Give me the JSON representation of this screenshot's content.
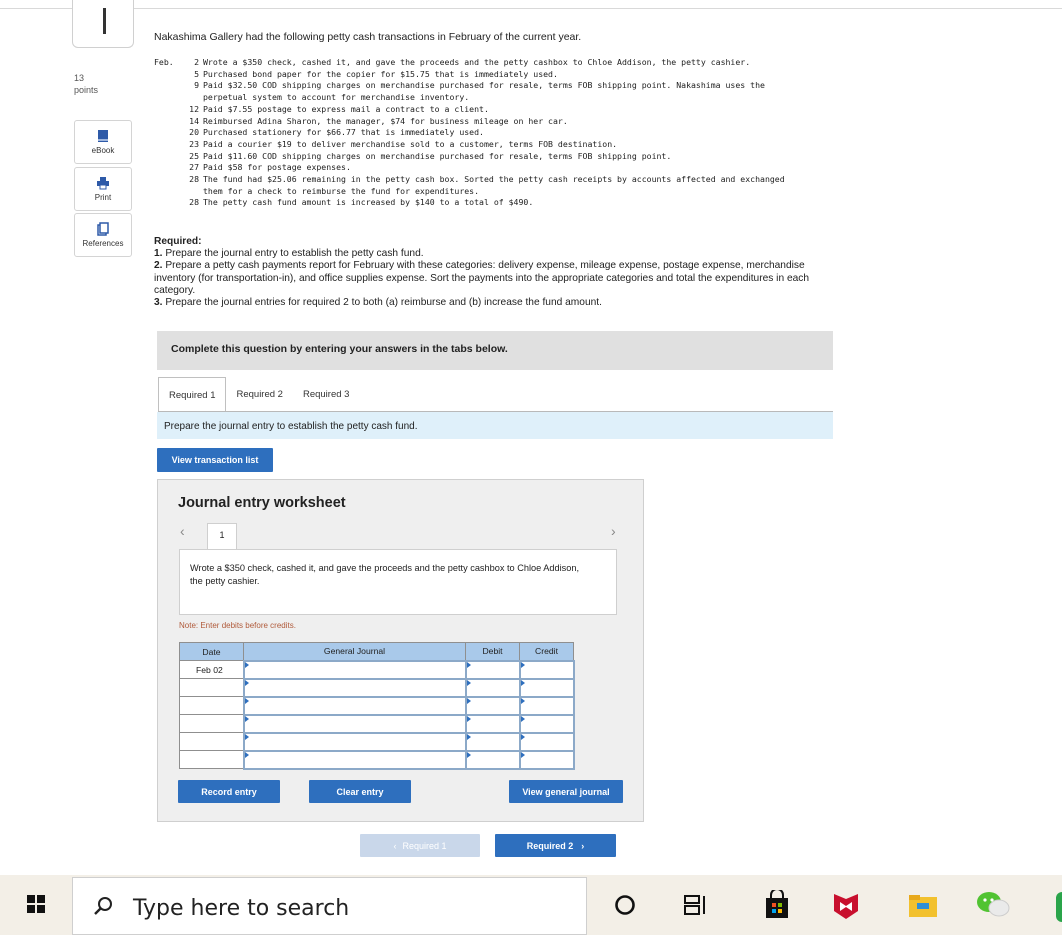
{
  "sidebar": {
    "points_value": "13",
    "points_label": "points",
    "buttons": [
      {
        "label": "eBook",
        "icon": "book-icon"
      },
      {
        "label": "Print",
        "icon": "printer-icon"
      },
      {
        "label": "References",
        "icon": "references-icon"
      }
    ]
  },
  "question": {
    "intro": "Nakashima Gallery had the following petty cash transactions in February of the current year.",
    "month": "Feb.",
    "transactions": [
      {
        "day": "2",
        "text": "Wrote a $350 check, cashed it, and gave the proceeds and the petty cashbox to Chloe Addison, the petty cashier."
      },
      {
        "day": "5",
        "text": "Purchased bond paper for the copier for $15.75 that is immediately used."
      },
      {
        "day": "9",
        "text": "Paid $32.50 COD shipping charges on merchandise purchased for resale, terms FOB shipping point. Nakashima uses the"
      },
      {
        "day": "",
        "text": "perpetual system to account for merchandise inventory."
      },
      {
        "day": "12",
        "text": "Paid $7.55 postage to express mail a contract to a client."
      },
      {
        "day": "14",
        "text": "Reimbursed Adina Sharon, the manager, $74 for business mileage on her car."
      },
      {
        "day": "20",
        "text": "Purchased stationery for $66.77 that is immediately used."
      },
      {
        "day": "23",
        "text": "Paid a courier $19 to deliver merchandise sold to a customer, terms FOB destination."
      },
      {
        "day": "25",
        "text": "Paid $11.60 COD shipping charges on merchandise purchased for resale, terms FOB shipping point."
      },
      {
        "day": "27",
        "text": "Paid $58 for postage expenses."
      },
      {
        "day": "28",
        "text": "The fund had $25.06 remaining in the petty cash box. Sorted the petty cash receipts by accounts affected and exchanged"
      },
      {
        "day": "",
        "text": "them for a check to reimburse the fund for expenditures."
      },
      {
        "day": "28",
        "text": "The petty cash fund amount is increased by $140 to a total of $490."
      }
    ],
    "required_heading": "Required:",
    "required": [
      {
        "num": "1.",
        "text": " Prepare the journal entry to establish the petty cash fund."
      },
      {
        "num": "2.",
        "text": " Prepare a petty cash payments report for February with these categories: delivery expense, mileage expense, postage expense, merchandise inventory (for transportation-in), and office supplies expense. Sort the payments into the appropriate categories and total the expenditures in each category."
      },
      {
        "num": "3.",
        "text": " Prepare the journal entries for required 2 to both (a) reimburse and (b) increase the fund amount."
      }
    ]
  },
  "banner": "Complete this question by entering your answers in the tabs below.",
  "tabs": [
    "Required 1",
    "Required 2",
    "Required 3"
  ],
  "tab_instruction": "Prepare the journal entry to establish the petty cash fund.",
  "view_transaction_button": "View transaction list",
  "worksheet": {
    "title": "Journal entry worksheet",
    "prev_icon": "chevron-left-icon",
    "next_icon": "chevron-right-icon",
    "page": "1",
    "description": "Wrote a $350 check, cashed it, and gave the proceeds and the petty cashbox to Chloe Addison, the petty cashier.",
    "note": "Note: Enter debits before credits.",
    "columns": [
      "Date",
      "General Journal",
      "Debit",
      "Credit"
    ],
    "rows": [
      {
        "date": "Feb 02",
        "account": "",
        "debit": "",
        "credit": ""
      },
      {
        "date": "",
        "account": "",
        "debit": "",
        "credit": ""
      },
      {
        "date": "",
        "account": "",
        "debit": "",
        "credit": ""
      },
      {
        "date": "",
        "account": "",
        "debit": "",
        "credit": ""
      },
      {
        "date": "",
        "account": "",
        "debit": "",
        "credit": ""
      },
      {
        "date": "",
        "account": "",
        "debit": "",
        "credit": ""
      }
    ],
    "buttons": {
      "record": "Record entry",
      "clear": "Clear entry",
      "view_journal": "View general journal"
    }
  },
  "nav": {
    "prev": "Required 1",
    "next": "Required 2"
  },
  "taskbar": {
    "search_placeholder": "Type here to search",
    "icons": [
      "windows-start-icon",
      "cortana-icon",
      "task-view-icon",
      "store-icon",
      "mcafee-icon",
      "file-explorer-icon",
      "wechat-icon"
    ]
  },
  "colors": {
    "accent_blue": "#2e6fbe",
    "header_blue": "#a9c9ea",
    "instruction_bg": "#dff0fa",
    "note_color": "#b05a3a"
  }
}
